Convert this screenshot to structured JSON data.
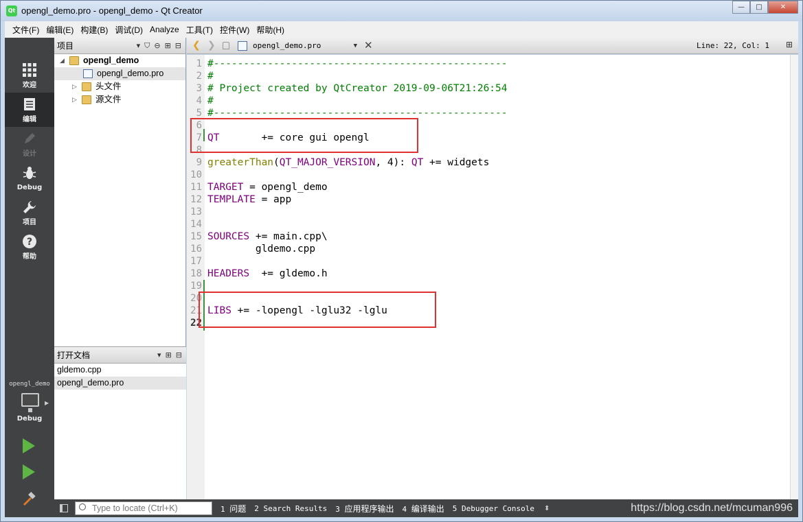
{
  "window": {
    "title": "opengl_demo.pro - opengl_demo - Qt Creator",
    "app_icon_text": "Qt",
    "buttons": {
      "minimize": "—",
      "maximize": "□",
      "close": "✕"
    }
  },
  "menubar": {
    "items": [
      "文件(F)",
      "编辑(E)",
      "构建(B)",
      "调试(D)",
      "Analyze",
      "工具(T)",
      "控件(W)",
      "帮助(H)"
    ]
  },
  "modebar": {
    "modes": [
      {
        "label": "欢迎",
        "icon": "grid-icon"
      },
      {
        "label": "编辑",
        "icon": "document-icon"
      },
      {
        "label": "设计",
        "icon": "pencil-icon"
      },
      {
        "label": "Debug",
        "icon": "bug-icon"
      },
      {
        "label": "项目",
        "icon": "wrench-icon"
      },
      {
        "label": "帮助",
        "icon": "help-icon"
      }
    ],
    "kit": {
      "project": "opengl_demo",
      "config": "Debug"
    }
  },
  "project_pane": {
    "title": "项目",
    "tree": {
      "root": "opengl_demo",
      "file": "opengl_demo.pro",
      "headers": "头文件",
      "sources": "源文件"
    }
  },
  "open_documents": {
    "title": "打开文档",
    "files": [
      "gldemo.cpp",
      "opengl_demo.pro"
    ]
  },
  "editor_toolbar": {
    "current_file": "opengl_demo.pro",
    "position": "Line: 22, Col: 1"
  },
  "code": {
    "lines": [
      {
        "n": "1",
        "tokens": [
          [
            "cmt",
            "#-------------------------------------------------"
          ]
        ]
      },
      {
        "n": "2",
        "tokens": [
          [
            "cmt",
            "#"
          ]
        ]
      },
      {
        "n": "3",
        "tokens": [
          [
            "cmt",
            "# Project created by QtCreator 2019-09-06T21:26:54"
          ]
        ]
      },
      {
        "n": "4",
        "tokens": [
          [
            "cmt",
            "#"
          ]
        ]
      },
      {
        "n": "5",
        "tokens": [
          [
            "cmt",
            "#-------------------------------------------------"
          ]
        ]
      },
      {
        "n": "6",
        "tokens": []
      },
      {
        "n": "7",
        "tokens": [
          [
            "var",
            "QT"
          ],
          [
            "txt",
            "       += core gui opengl"
          ]
        ]
      },
      {
        "n": "8",
        "tokens": []
      },
      {
        "n": "9",
        "tokens": [
          [
            "func",
            "greaterThan"
          ],
          [
            "txt",
            "("
          ],
          [
            "var",
            "QT_MAJOR_VERSION"
          ],
          [
            "txt",
            ", 4): "
          ],
          [
            "var",
            "QT"
          ],
          [
            "txt",
            " += widgets"
          ]
        ]
      },
      {
        "n": "10",
        "tokens": []
      },
      {
        "n": "11",
        "tokens": [
          [
            "var",
            "TARGET"
          ],
          [
            "txt",
            " = opengl_demo"
          ]
        ]
      },
      {
        "n": "12",
        "tokens": [
          [
            "var",
            "TEMPLATE"
          ],
          [
            "txt",
            " = app"
          ]
        ]
      },
      {
        "n": "13",
        "tokens": []
      },
      {
        "n": "14",
        "tokens": []
      },
      {
        "n": "15",
        "tokens": [
          [
            "var",
            "SOURCES"
          ],
          [
            "txt",
            " += main.cpp\\"
          ]
        ]
      },
      {
        "n": "16",
        "tokens": [
          [
            "txt",
            "        gldemo.cpp"
          ]
        ]
      },
      {
        "n": "17",
        "tokens": []
      },
      {
        "n": "18",
        "tokens": [
          [
            "var",
            "HEADERS"
          ],
          [
            "txt",
            "  += gldemo.h"
          ]
        ]
      },
      {
        "n": "19",
        "tokens": []
      },
      {
        "n": "20",
        "tokens": []
      },
      {
        "n": "21",
        "tokens": [
          [
            "var",
            "LIBS"
          ],
          [
            "txt",
            " += -lopengl -lglu32 -lglu"
          ]
        ]
      },
      {
        "n": "22",
        "tokens": []
      }
    ],
    "current_line": "22"
  },
  "bottombar": {
    "locator_placeholder": "Type to locate (Ctrl+K)",
    "tabs": [
      {
        "num": "1",
        "label": "问题"
      },
      {
        "num": "2",
        "label": "Search Results"
      },
      {
        "num": "3",
        "label": "应用程序输出"
      },
      {
        "num": "4",
        "label": "编译输出"
      },
      {
        "num": "5",
        "label": "Debugger Console"
      }
    ],
    "watermark": "https://blog.csdn.net/mcuman996"
  },
  "colors": {
    "comment": "#008000",
    "variable": "#800080",
    "function": "#808000",
    "highlight_box": "#e03030",
    "modebar": "#404244",
    "run": "#5fb543"
  }
}
